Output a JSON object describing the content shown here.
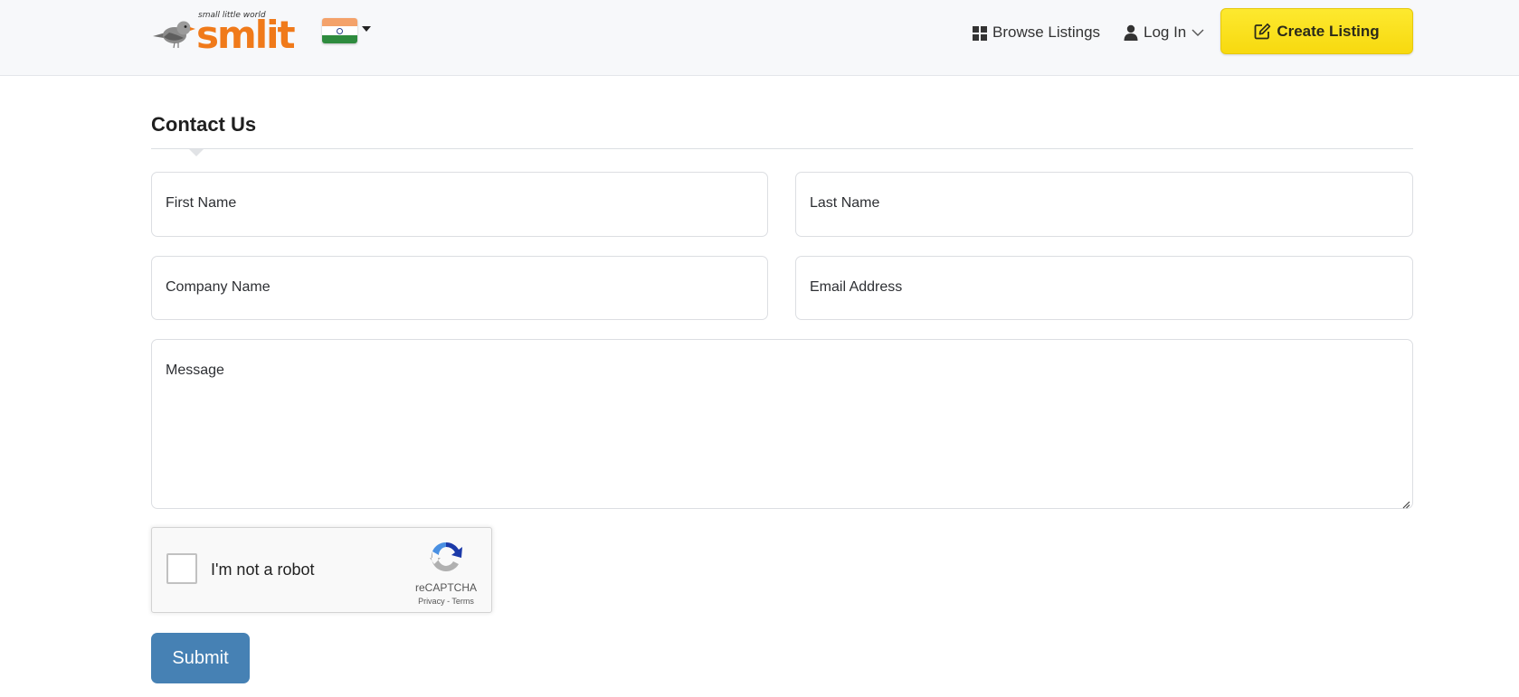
{
  "header": {
    "logo": {
      "tagline": "small little world",
      "wordmark": "smlit",
      "brand_color": "#f07a1a"
    },
    "country_selector": {
      "selected": "India",
      "icon": "india-flag-icon"
    },
    "nav": {
      "browse_label": "Browse Listings",
      "browse_icon": "grid-icon",
      "login_label": "Log In",
      "login_icon": "user-icon"
    },
    "create_listing": {
      "label": "Create Listing",
      "icon": "edit-icon",
      "color": "#fbe122"
    }
  },
  "page": {
    "title": "Contact Us"
  },
  "form": {
    "first_name": {
      "placeholder": "First Name",
      "value": ""
    },
    "last_name": {
      "placeholder": "Last Name",
      "value": ""
    },
    "company_name": {
      "placeholder": "Company Name",
      "value": ""
    },
    "email": {
      "placeholder": "Email Address",
      "value": ""
    },
    "message": {
      "placeholder": "Message",
      "value": ""
    },
    "captcha": {
      "label": "I'm not a robot",
      "brand": "reCAPTCHA",
      "privacy": "Privacy",
      "separator": " - ",
      "terms": "Terms",
      "checked": false
    },
    "submit": {
      "label": "Submit",
      "color": "#4681b4"
    }
  }
}
